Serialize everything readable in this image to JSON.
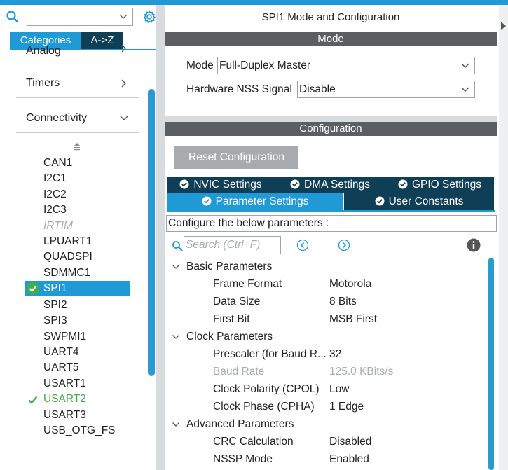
{
  "left_panel": {
    "search_value": "",
    "tabs": {
      "categories": "Categories",
      "az": "A->Z"
    },
    "categories": [
      {
        "label": "Analog"
      },
      {
        "label": "Timers"
      },
      {
        "label": "Connectivity"
      }
    ],
    "peripherals": [
      {
        "label": "CAN1",
        "state": "normal"
      },
      {
        "label": "I2C1",
        "state": "normal"
      },
      {
        "label": "I2C2",
        "state": "normal"
      },
      {
        "label": "I2C3",
        "state": "normal"
      },
      {
        "label": "IRTIM",
        "state": "disabled"
      },
      {
        "label": "LPUART1",
        "state": "normal"
      },
      {
        "label": "QUADSPI",
        "state": "normal"
      },
      {
        "label": "SDMMC1",
        "state": "normal"
      },
      {
        "label": "SPI1",
        "state": "selected"
      },
      {
        "label": "SPI2",
        "state": "normal"
      },
      {
        "label": "SPI3",
        "state": "normal"
      },
      {
        "label": "SWPMI1",
        "state": "normal"
      },
      {
        "label": "UART4",
        "state": "normal"
      },
      {
        "label": "UART5",
        "state": "normal"
      },
      {
        "label": "USART1",
        "state": "normal"
      },
      {
        "label": "USART2",
        "state": "configured"
      },
      {
        "label": "USART3",
        "state": "normal"
      },
      {
        "label": "USB_OTG_FS",
        "state": "normal"
      }
    ]
  },
  "right_panel": {
    "title": "SPI1 Mode and Configuration",
    "mode_section": "Mode",
    "mode_label": "Mode",
    "mode_value": "Full-Duplex Master",
    "nss_label": "Hardware NSS Signal",
    "nss_value": "Disable",
    "config_section": "Configuration",
    "reset_button": "Reset Configuration",
    "tabs": {
      "nvic": "NVIC Settings",
      "dma": "DMA Settings",
      "gpio": "GPIO Settings",
      "param": "Parameter Settings",
      "user": "User Constants"
    },
    "hint": "Configure the below parameters :",
    "search_placeholder": "Search (Ctrl+F)",
    "groups": {
      "basic": "Basic Parameters",
      "clock": "Clock Parameters",
      "advanced": "Advanced Parameters"
    },
    "params": {
      "frame_format": {
        "name": "Frame Format",
        "value": "Motorola"
      },
      "data_size": {
        "name": "Data Size",
        "value": "8 Bits"
      },
      "first_bit": {
        "name": "First Bit",
        "value": "MSB First"
      },
      "prescaler": {
        "name": "Prescaler (for Baud R...",
        "value": "32"
      },
      "baud_rate": {
        "name": "Baud Rate",
        "value": "125.0 KBits/s"
      },
      "cpol": {
        "name": "Clock Polarity (CPOL)",
        "value": "Low"
      },
      "cpha": {
        "name": "Clock Phase (CPHA)",
        "value": "1 Edge"
      },
      "crc": {
        "name": "CRC Calculation",
        "value": "Disabled"
      },
      "nssp": {
        "name": "NSSP Mode",
        "value": "Enabled"
      }
    }
  },
  "colors": {
    "accent": "#1f9ad6",
    "dark_tab": "#0f3e57",
    "section_bar": "#5c5f61",
    "ok_green": "#3fae49"
  }
}
